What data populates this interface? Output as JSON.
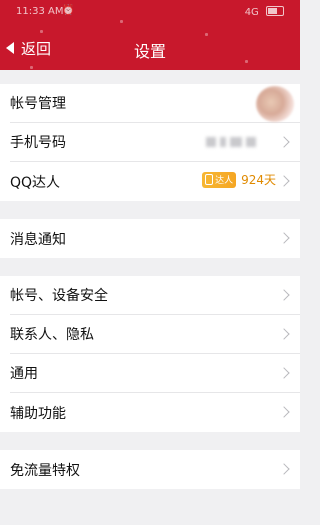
{
  "status_bar": {
    "time": "11:33 AM",
    "alarm_icon": "alarm-icon",
    "network": "4G"
  },
  "header": {
    "back_label": "返回",
    "title": "设置",
    "background": "#c8182c"
  },
  "sections": [
    {
      "rows": [
        {
          "label": "帐号管理"
        },
        {
          "label": "手机号码"
        },
        {
          "label": "QQ达人",
          "badge_text": "达人",
          "days": "924天"
        }
      ]
    },
    {
      "rows": [
        {
          "label": "消息通知"
        }
      ]
    },
    {
      "rows": [
        {
          "label": "帐号、设备安全"
        },
        {
          "label": "联系人、隐私"
        },
        {
          "label": "通用"
        },
        {
          "label": "辅助功能"
        }
      ]
    },
    {
      "rows": [
        {
          "label": "免流量特权"
        }
      ]
    }
  ]
}
